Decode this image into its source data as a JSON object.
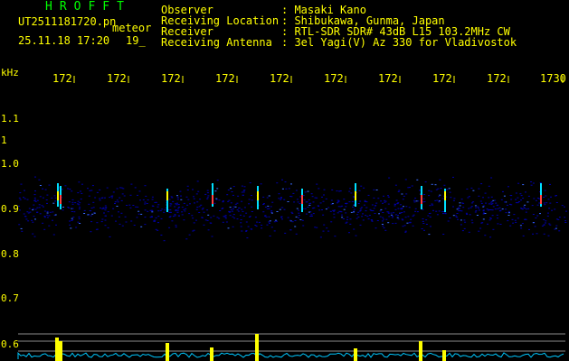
{
  "header": {
    "brand": "HROFFT",
    "file_name": "UT2511181720.pn",
    "meteor_tag": "meteor",
    "datetime": "25.11.18 17:20",
    "count": "19_",
    "fields": [
      {
        "label": "Observer",
        "value": ": Masaki Kano"
      },
      {
        "label": "Receiving Location",
        "value": ": Shibukawa, Gunma, Japan"
      },
      {
        "label": "Receiver",
        "value": ": RTL-SDR SDR# 43dB L15 103.2MHz CW"
      },
      {
        "label": "Receiving Antenna",
        "value": ": 3el Yagi(V) Az 330 for Vladivostok"
      }
    ]
  },
  "axes": {
    "y_unit": "kHz",
    "x_ticks": [
      "172",
      "172",
      "172",
      "172",
      "172",
      "172",
      "172",
      "172",
      "172",
      "1730"
    ],
    "y_ticks": [
      "1.1",
      "1",
      "1.0",
      "0.9",
      "0.8",
      "0.7",
      "0.6"
    ]
  },
  "colors": {
    "background": "#000000",
    "text": "#ffff00",
    "brand": "#00ff00",
    "noise": "#0000aa",
    "spectrum": "#00c8ff",
    "echo": "#ffff00"
  }
}
